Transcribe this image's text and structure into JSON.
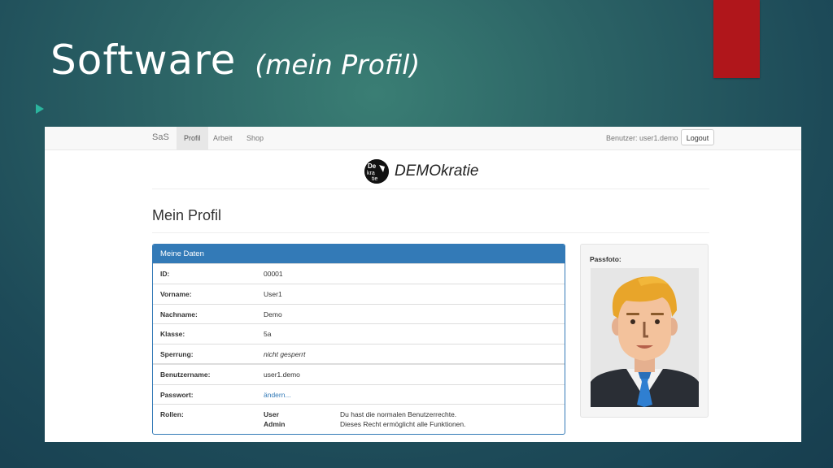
{
  "slide": {
    "title": "Software",
    "subtitle": "(mein Profil)",
    "accent_color": "#b0161b"
  },
  "app": {
    "brand": "SaS",
    "nav": [
      {
        "label": "Profil",
        "active": true
      },
      {
        "label": "Arbeit",
        "active": false
      },
      {
        "label": "Shop",
        "active": false
      }
    ],
    "user_label": "Benutzer: user1.demo",
    "logout_label": "Logout",
    "logo_text": "DEMOkratie",
    "page_title": "Mein Profil",
    "panel_title": "Meine Daten",
    "fields": {
      "id": {
        "label": "ID:",
        "value": "00001"
      },
      "vorname": {
        "label": "Vorname:",
        "value": "User1"
      },
      "nachname": {
        "label": "Nachname:",
        "value": "Demo"
      },
      "klasse": {
        "label": "Klasse:",
        "value": "5a"
      },
      "sperrung": {
        "label": "Sperrung:",
        "value": "nicht gesperrt"
      },
      "benutzername": {
        "label": "Benutzername:",
        "value": "user1.demo"
      },
      "passwort": {
        "label": "Passwort:",
        "value": "ändern..."
      },
      "rollen": {
        "label": "Rollen:"
      }
    },
    "roles": [
      {
        "name": "User",
        "description": "Du hast die normalen Benutzerrechte."
      },
      {
        "name": "Admin",
        "description": "Dieses Recht ermöglicht alle Funktionen."
      }
    ],
    "photo_label": "Passfoto:",
    "primary_color": "#337ab7"
  }
}
